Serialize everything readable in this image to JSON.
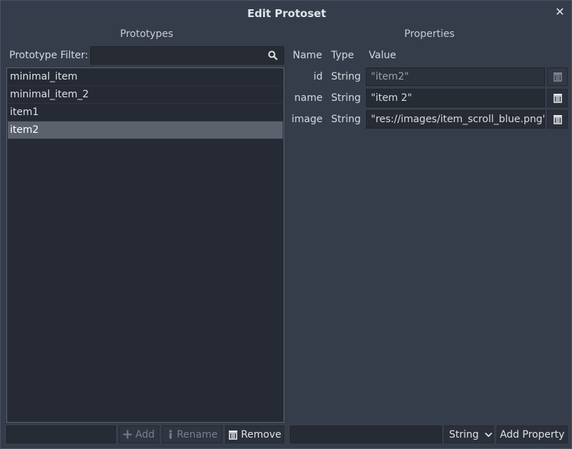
{
  "window": {
    "title": "Edit Protoset"
  },
  "icons": {
    "close": "close-icon",
    "search": "search-icon",
    "trash": "trash-icon",
    "add": "plus-icon",
    "rename": "pencil-icon",
    "dropdown": "chevron-down-icon"
  },
  "prototypes": {
    "header": "Prototypes",
    "filter_label": "Prototype Filter:",
    "filter_value": "",
    "items": [
      {
        "label": "minimal_item"
      },
      {
        "label": "minimal_item_2"
      },
      {
        "label": "item1"
      },
      {
        "label": "item2",
        "selected": true
      }
    ],
    "new_name_value": "",
    "add_label": "Add",
    "rename_label": "Rename",
    "remove_label": "Remove"
  },
  "properties": {
    "header": "Properties",
    "col_name": "Name",
    "col_type": "Type",
    "col_value": "Value",
    "rows": [
      {
        "name": "id",
        "type": "String",
        "value": "\"item2\""
      },
      {
        "name": "name",
        "type": "String",
        "value": "\"item 2\""
      },
      {
        "name": "image",
        "type": "String",
        "value": "\"res://images/item_scroll_blue.png\""
      }
    ],
    "new_property_name": "",
    "type_selected": "String",
    "add_property_label": "Add Property"
  }
}
